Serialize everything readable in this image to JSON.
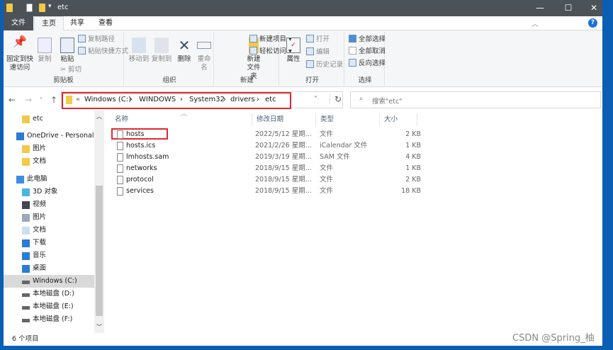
{
  "window": {
    "title": "etc",
    "controls": [
      "minimize",
      "maximize",
      "close"
    ]
  },
  "tabs": [
    {
      "label": "文件"
    },
    {
      "label": "主页"
    },
    {
      "label": "共享"
    },
    {
      "label": "查看"
    }
  ],
  "ribbon": {
    "clipboard": {
      "label": "剪贴板",
      "pin": "固定到快速访问",
      "copy": "复制",
      "paste": "粘贴",
      "copy_path": "复制路径",
      "paste_shortcut": "粘贴快捷方式",
      "cut": "剪切"
    },
    "organize": {
      "label": "组织",
      "move_to": "移动到",
      "copy_to": "复制到",
      "delete": "删除",
      "rename": "重命名"
    },
    "new": {
      "label": "新建",
      "new_folder": "新建文件夹",
      "new_item": "新建项目",
      "easy_access": "轻松访问"
    },
    "open": {
      "label": "打开",
      "properties": "属性",
      "open": "打开",
      "edit": "编辑",
      "history": "历史记录"
    },
    "select": {
      "label": "选择",
      "select_all": "全部选择",
      "select_none": "全部取消",
      "invert": "反向选择"
    }
  },
  "address": {
    "crumbs": [
      "«",
      "Windows (C:)",
      "›",
      "WINDOWS",
      "›",
      "System32",
      "›",
      "drivers",
      "›",
      "etc"
    ],
    "search_placeholder": "搜索\"etc\""
  },
  "nav": [
    {
      "label": "etc",
      "icon": "folder-icon"
    },
    {
      "label": "OneDrive - Personal",
      "icon": "cloud-icon"
    },
    {
      "label": "图片",
      "icon": "folder-icon"
    },
    {
      "label": "文档",
      "icon": "folder-icon"
    },
    {
      "label": "此电脑",
      "icon": "computer-icon"
    },
    {
      "label": "3D 对象",
      "icon": "cube-icon"
    },
    {
      "label": "视频",
      "icon": "video-icon"
    },
    {
      "label": "图片",
      "icon": "picture-icon"
    },
    {
      "label": "文档",
      "icon": "document-icon"
    },
    {
      "label": "下载",
      "icon": "download-icon"
    },
    {
      "label": "音乐",
      "icon": "music-icon"
    },
    {
      "label": "桌面",
      "icon": "desktop-icon"
    },
    {
      "label": "Windows (C:)",
      "icon": "drive-icon",
      "selected": true
    },
    {
      "label": "本地磁盘 (D:)",
      "icon": "drive-icon"
    },
    {
      "label": "本地磁盘 (E:)",
      "icon": "drive-icon"
    },
    {
      "label": "本地磁盘 (F:)",
      "icon": "drive-icon"
    }
  ],
  "columns": {
    "name": "名称",
    "date": "修改日期",
    "type": "类型",
    "size": "大小"
  },
  "files": [
    {
      "name": "hosts",
      "date": "2022/5/12 星期...",
      "type": "文件",
      "size": "2 KB"
    },
    {
      "name": "hosts.ics",
      "date": "2021/2/26 星期...",
      "type": "iCalendar 文件",
      "size": "1 KB"
    },
    {
      "name": "lmhosts.sam",
      "date": "2019/3/19 星期...",
      "type": "SAM 文件",
      "size": "4 KB"
    },
    {
      "name": "networks",
      "date": "2018/9/15 星期...",
      "type": "文件",
      "size": "1 KB"
    },
    {
      "name": "protocol",
      "date": "2018/9/15 星期...",
      "type": "文件",
      "size": "2 KB"
    },
    {
      "name": "services",
      "date": "2018/9/15 星期...",
      "type": "文件",
      "size": "18 KB"
    }
  ],
  "status": "6 个项目",
  "watermark": "CSDN @Spring_柚"
}
